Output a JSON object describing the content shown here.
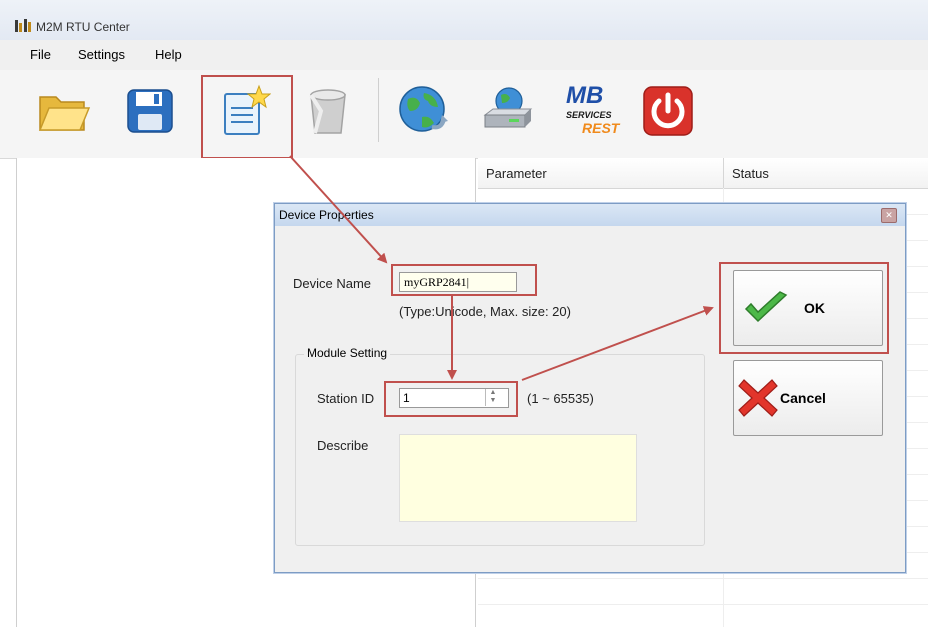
{
  "window": {
    "title": "M2M RTU Center"
  },
  "menu": {
    "items": [
      "File",
      "Settings",
      "Help"
    ]
  },
  "toolbar": {
    "buttons": [
      "open-folder",
      "save",
      "new-device",
      "delete",
      "connect-web",
      "network-drive",
      "mb-services-rest",
      "power"
    ],
    "mb_label": "MB",
    "services_label": "SERVICES",
    "rest_label": "REST"
  },
  "grid": {
    "columns": [
      "Parameter",
      "Status"
    ]
  },
  "dialog": {
    "title": "Device Properties",
    "device_name_label": "Device Name",
    "device_name_value": "myGRP2841|",
    "device_name_hint": "(Type:Unicode, Max. size: 20)",
    "module_setting_label": "Module Setting",
    "station_id_label": "Station ID",
    "station_id_value": "1",
    "station_id_range": "(1 ~ 65535)",
    "describe_label": "Describe",
    "describe_value": "",
    "ok_label": "OK",
    "cancel_label": "Cancel"
  },
  "colors": {
    "annotation": "#c0504d",
    "accent": "#7d9cc4",
    "describe_bg": "#ffffe0"
  }
}
